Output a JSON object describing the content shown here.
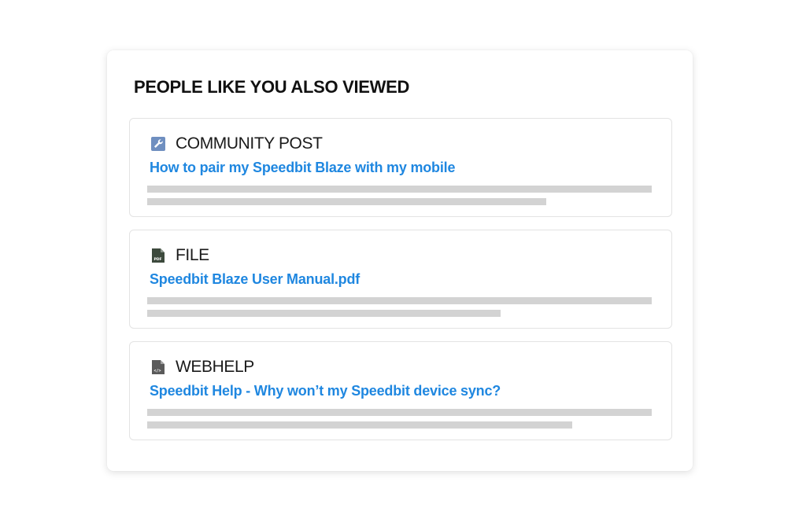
{
  "panel": {
    "title": "PEOPLE LIKE YOU ALSO VIEWED"
  },
  "items": [
    {
      "type_label": "COMMUNITY POST",
      "icon": "wrench-icon",
      "link": "How to pair my Speedbit Blaze with my mobile"
    },
    {
      "type_label": "FILE",
      "icon": "pdf-file-icon",
      "link": "Speedbit Blaze User Manual.pdf"
    },
    {
      "type_label": "WEBHELP",
      "icon": "code-file-icon",
      "link": "Speedbit Help - Why won’t my Speedbit device sync?"
    }
  ],
  "colors": {
    "link": "#1f87e0",
    "placeholder_bar": "#d3d3d3",
    "community_icon": "#6f8fc0",
    "file_icon": "#3d4a3d",
    "webhelp_icon": "#5a5a5a"
  }
}
